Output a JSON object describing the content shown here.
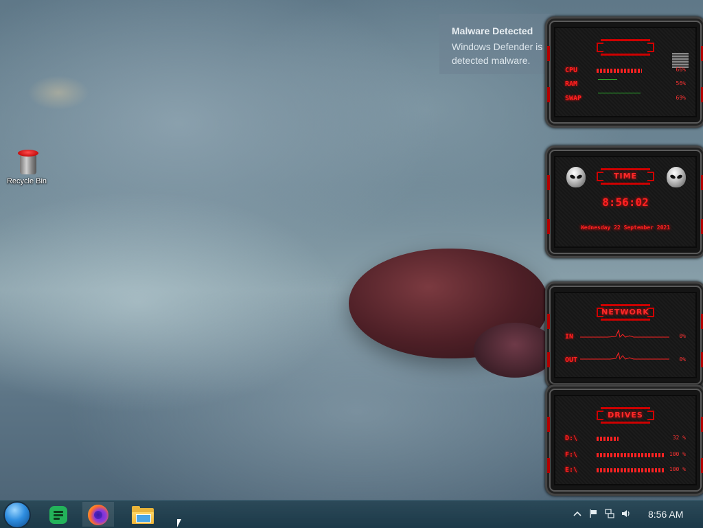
{
  "desktop": {
    "icons": [
      {
        "label": "Recycle Bin",
        "icon": "recycle-bin-icon"
      }
    ]
  },
  "notification": {
    "title": "Malware Detected",
    "message": "Windows Defender is taking action to clean detected malware."
  },
  "gadgets": {
    "system": {
      "rows": [
        {
          "key": "CPU",
          "value": "66%",
          "level": 0.66
        },
        {
          "key": "RAM",
          "value": "56%",
          "level": 0.56
        },
        {
          "key": "SWAP",
          "value": "69%",
          "level": 0.69
        }
      ]
    },
    "time": {
      "title": "TIME",
      "clock": "8:56:02",
      "date": "Wednesday 22 September 2021"
    },
    "network": {
      "title": "NETWORK",
      "rows": [
        {
          "key": "IN",
          "value": "0%"
        },
        {
          "key": "OUT",
          "value": "0%"
        }
      ]
    },
    "drives": {
      "title": "DRIVES",
      "rows": [
        {
          "key": "D:\\",
          "value": "32 %",
          "level": 0.32
        },
        {
          "key": "F:\\",
          "value": "100 %",
          "level": 1.0
        },
        {
          "key": "E:\\",
          "value": "100 %",
          "level": 1.0
        }
      ]
    }
  },
  "taskbar": {
    "start_icon": "start-orb-icon",
    "apps": [
      {
        "name": "notes-app",
        "icon": "green-notes-icon"
      },
      {
        "name": "firefox",
        "icon": "firefox-icon",
        "active": true
      },
      {
        "name": "file-explorer",
        "icon": "folder-icon"
      }
    ],
    "tray_icons": [
      "chevron-up-icon",
      "flag-icon",
      "network-icon",
      "volume-icon"
    ],
    "clock": "8:56 AM"
  },
  "colors": {
    "accent_red": "#ff2222",
    "taskbar": "#1f4656"
  }
}
